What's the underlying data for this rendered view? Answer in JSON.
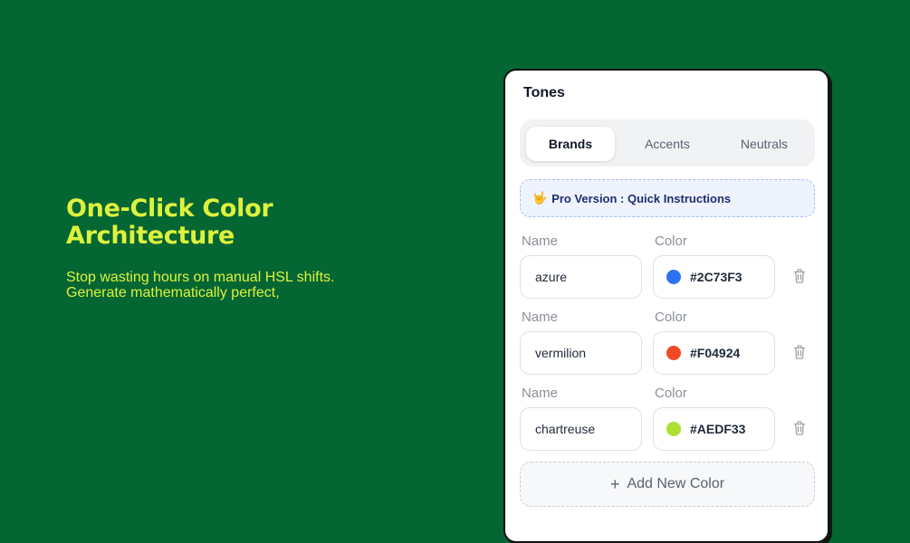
{
  "hero": {
    "title": "One-Click Color Architecture",
    "subtitle": "Stop wasting hours on manual HSL shifts. Generate mathematically perfect,"
  },
  "panel": {
    "title": "Tones",
    "tabs": [
      {
        "label": "Brands",
        "active": true
      },
      {
        "label": "Accents",
        "active": false
      },
      {
        "label": "Neutrals",
        "active": false
      }
    ],
    "pro_banner": {
      "icon": "🤟",
      "text": "Pro Version : Quick Instructions"
    },
    "colors": [
      {
        "name_label": "Name",
        "color_label": "Color",
        "name": "azure",
        "hex": "#2C73F3",
        "swatch": "#2C73F3"
      },
      {
        "name_label": "Name",
        "color_label": "Color",
        "name": "vermilion",
        "hex": "#F04924",
        "swatch": "#F04924"
      },
      {
        "name_label": "Name",
        "color_label": "Color",
        "name": "chartreuse",
        "hex": "#AEDF33",
        "swatch": "#AEDF33"
      }
    ],
    "add_button": {
      "icon": "+",
      "label": "Add New Color"
    }
  },
  "theme": {
    "background": "#046633",
    "accent": "#DDF23D"
  }
}
